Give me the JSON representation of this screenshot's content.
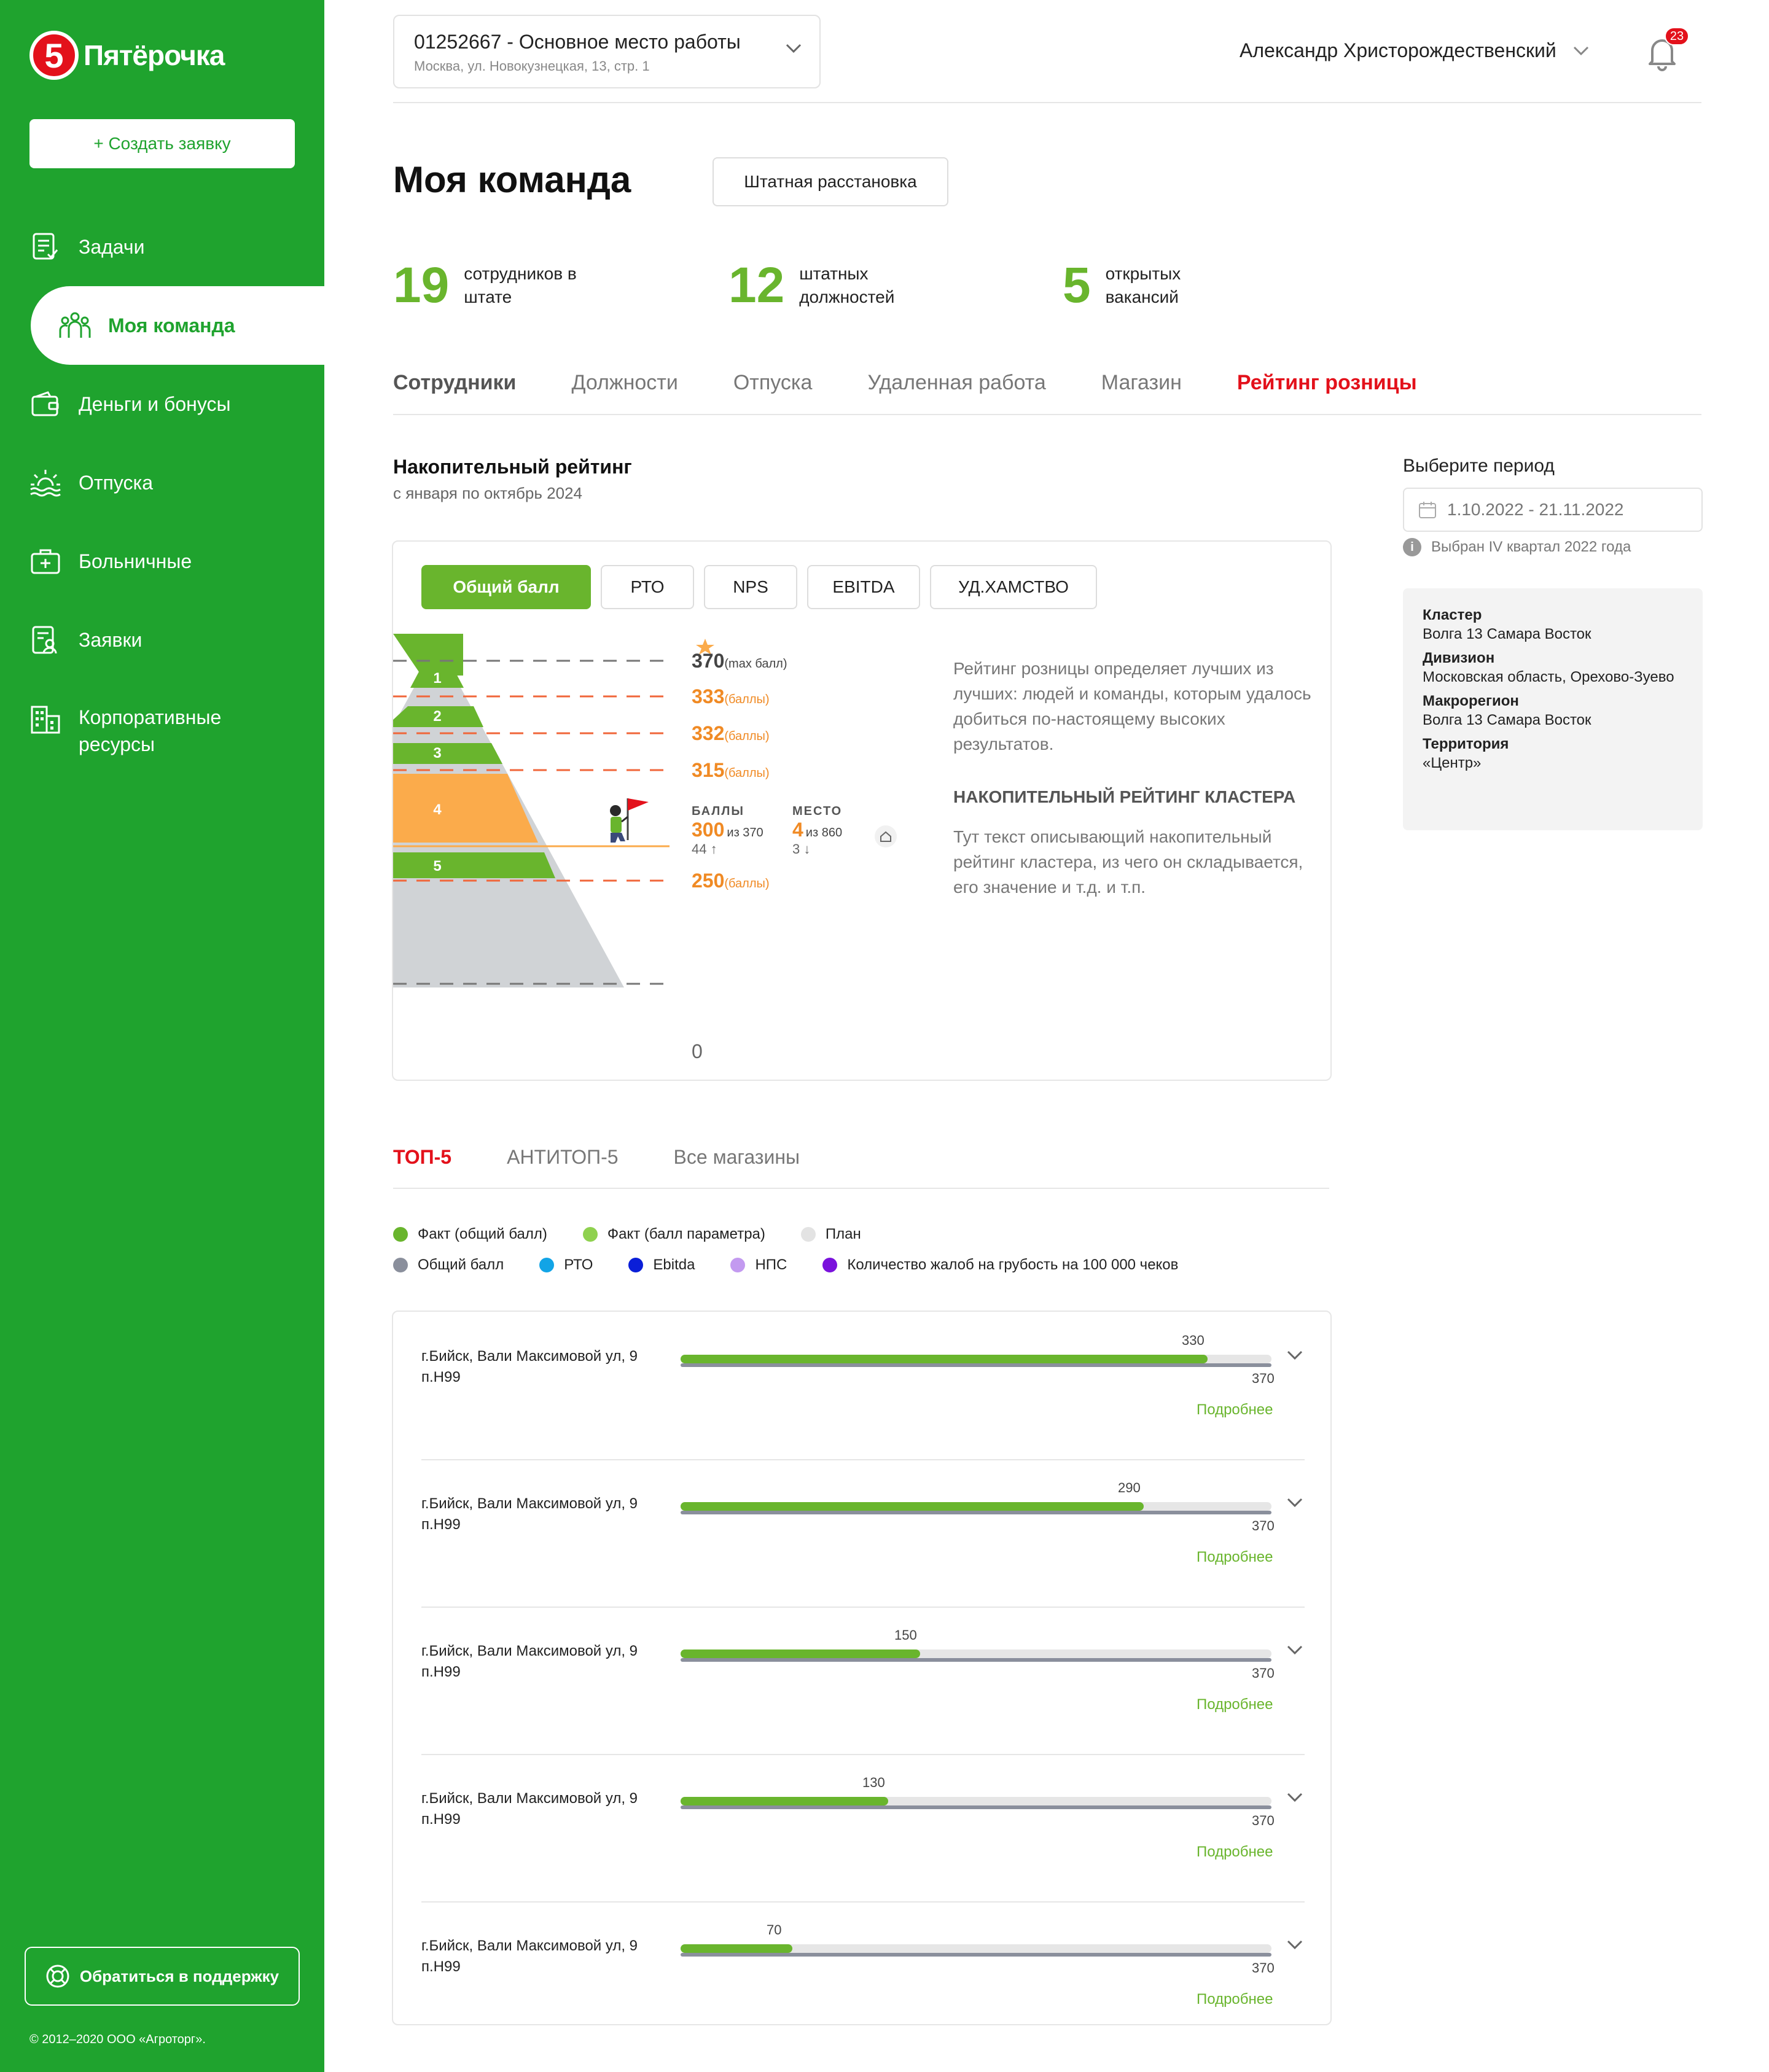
{
  "sidebar": {
    "logo_text": "Пятёрочка",
    "logo_digit": "5",
    "create_label": "+ Создать заявку",
    "items": [
      {
        "label": "Задачи"
      },
      {
        "label": "Моя команда"
      },
      {
        "label": "Деньги и бонусы"
      },
      {
        "label": "Отпуска"
      },
      {
        "label": "Больничные"
      },
      {
        "label": "Заявки"
      },
      {
        "label": "Корпоративные ресурсы"
      }
    ],
    "support_label": "Обратиться в поддержку",
    "copyright": "© 2012–2020 ООО «Агроторг»."
  },
  "header": {
    "workplace_title": "01252667 - Основное место работы",
    "workplace_address": "Москва, ул. Новокузнецкая, 13, стр. 1",
    "user_name": "Александр Христорождественский",
    "notifications": "23"
  },
  "page": {
    "title": "Моя команда",
    "staff_button": "Штатная расстановка",
    "stats": [
      {
        "num": "19",
        "label": "сотрудников в штате"
      },
      {
        "num": "12",
        "label": "штатных должностей"
      },
      {
        "num": "5",
        "label": "открытых вакансий"
      }
    ],
    "tabs": [
      "Сотрудники",
      "Должности",
      "Отпуска",
      "Удаленная работа",
      "Магазин",
      "Рейтинг розницы"
    ],
    "active_tab": "Рейтинг розницы"
  },
  "rating": {
    "title": "Накопительный рейтинг",
    "subtitle": "с января по октябрь 2024",
    "pills": [
      "Общий балл",
      "РТО",
      "NPS",
      "EBITDA",
      "УД.ХАМСТВО"
    ],
    "active_pill": "Общий балл",
    "levels": [
      {
        "rank": "1",
        "score": "333",
        "unit": "(баллы)"
      },
      {
        "rank": "2",
        "score": "332",
        "unit": "(баллы)"
      },
      {
        "rank": "3",
        "score": "315",
        "unit": "(баллы)"
      },
      {
        "rank": "4",
        "score": "",
        "unit": ""
      },
      {
        "rank": "5",
        "score": "250",
        "unit": "(баллы)"
      }
    ],
    "max_score": "370",
    "max_unit": "(max балл)",
    "zero": "0",
    "current": {
      "points_head": "БАЛЛЫ",
      "points": "300",
      "points_of": "из 370",
      "points_delta": "44 ↑",
      "place_head": "МЕСТО",
      "place": "4",
      "place_of": "из 860",
      "place_delta": "3 ↓"
    },
    "description": "Рейтинг розницы определяет лучших из лучших: людей и команды, которым удалось добиться по-настоящему высоких результатов.",
    "cluster_title": "НАКОПИТЕЛЬНЫЙ РЕЙТИНГ КЛАСТЕРА",
    "cluster_text": "Тут текст описывающий накопительный рейтинг кластера, из чего он складывается, его значение и т.д. и т.п."
  },
  "period": {
    "title": "Выберите период",
    "value": "1.10.2022 - 21.11.2022",
    "note": "Выбран IV квартал 2022 года",
    "info": [
      {
        "label": "Кластер",
        "value": "Волга 13 Самара Восток"
      },
      {
        "label": "Дивизион",
        "value": "Московская область, Орехово-Зуево"
      },
      {
        "label": "Макрорегион",
        "value": "Волга 13 Самара Восток"
      },
      {
        "label": "Территория",
        "value": "«Центр»"
      }
    ]
  },
  "top": {
    "tabs": [
      "ТОП-5",
      "АНТИТОП-5",
      "Все магазины"
    ],
    "active_tab": "ТОП-5",
    "legend_row1": [
      {
        "label": "Факт (общий балл)",
        "color": "#69b52d"
      },
      {
        "label": "Факт (балл параметра)",
        "color": "#8fd14f"
      },
      {
        "label": "План",
        "color": "#e3e3e3"
      }
    ],
    "legend_row2": [
      {
        "label": "Общий балл",
        "color": "#8a8f9c"
      },
      {
        "label": "РТО",
        "color": "#12a4e6"
      },
      {
        "label": "Ebitda",
        "color": "#0a1ed8"
      },
      {
        "label": "НПС",
        "color": "#c39af0"
      },
      {
        "label": "Количество жалоб на грубость на 100 000 чеков",
        "color": "#7a12dc"
      }
    ],
    "plan": 370,
    "plan_label": "370",
    "more_label": "Подробнее",
    "rows": [
      {
        "addr1": "г.Бийск, Вали Максимовой ул, 9",
        "addr2": "п.Н99",
        "fact": 330,
        "fact_label": "330"
      },
      {
        "addr1": "г.Бийск, Вали Максимовой ул, 9",
        "addr2": "п.Н99",
        "fact": 290,
        "fact_label": "290"
      },
      {
        "addr1": "г.Бийск, Вали Максимовой ул, 9",
        "addr2": "п.Н99",
        "fact": 150,
        "fact_label": "150"
      },
      {
        "addr1": "г.Бийск, Вали Максимовой ул, 9",
        "addr2": "п.Н99",
        "fact": 130,
        "fact_label": "130"
      },
      {
        "addr1": "г.Бийск, Вали Максимовой ул, 9",
        "addr2": "п.Н99",
        "fact": 70,
        "fact_label": "70"
      }
    ]
  }
}
